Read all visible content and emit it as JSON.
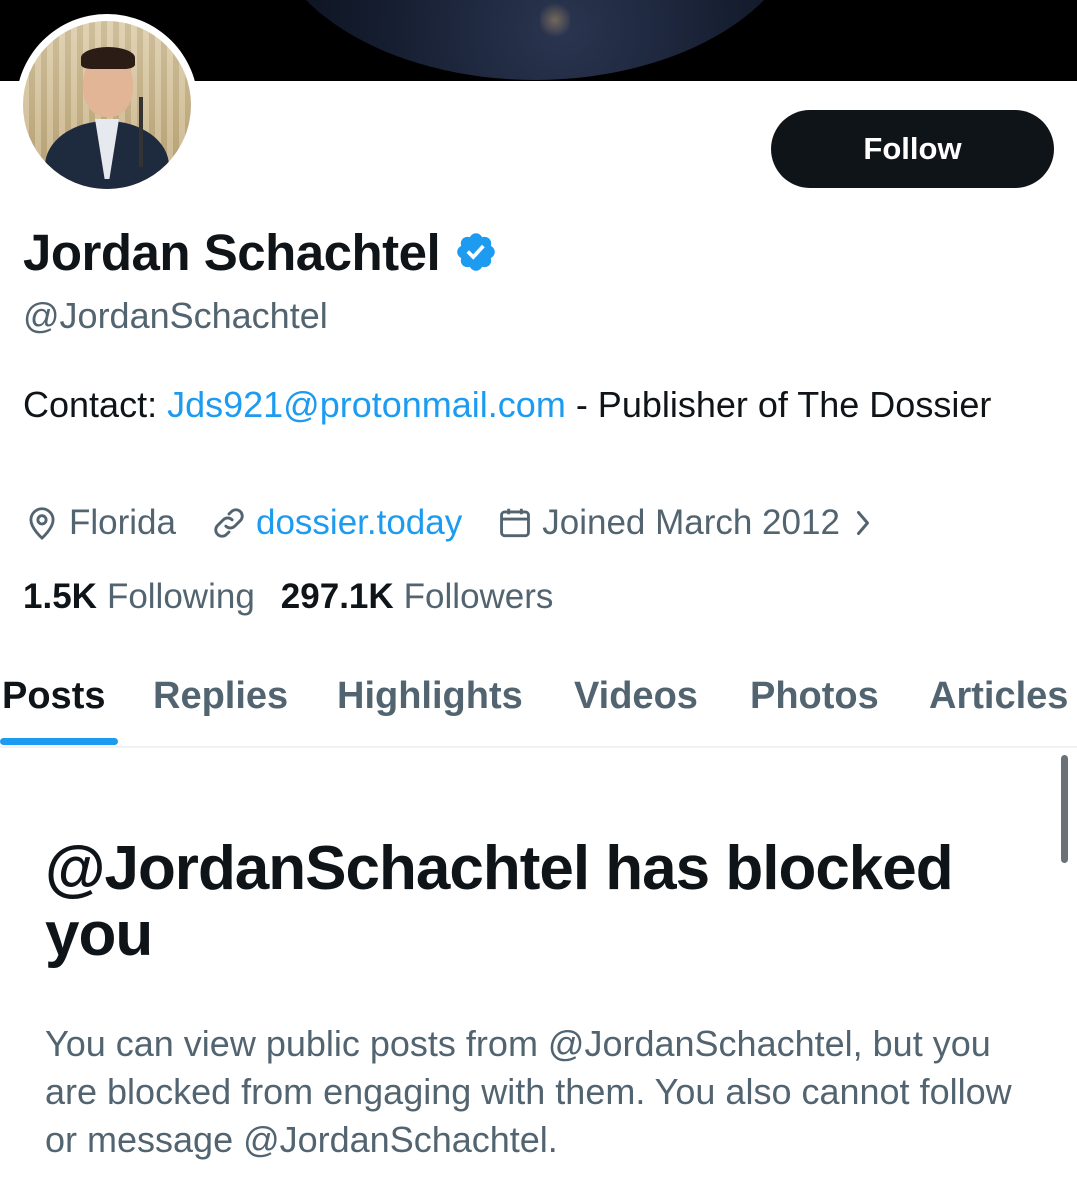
{
  "profile": {
    "display_name": "Jordan Schachtel",
    "handle": "@JordanSchachtel",
    "verified": true,
    "follow_label": "Follow",
    "bio": {
      "prefix": "Contact: ",
      "email_link": "Jds921@protonmail.com",
      "suffix": " - Publisher of The Dossier"
    },
    "location": "Florida",
    "website": "dossier.today",
    "joined": "Joined March 2012",
    "following_count": "1.5K",
    "following_label": "Following",
    "followers_count": "297.1K",
    "followers_label": "Followers"
  },
  "tabs": [
    {
      "label": "Posts",
      "active": true
    },
    {
      "label": "Replies",
      "active": false
    },
    {
      "label": "Highlights",
      "active": false
    },
    {
      "label": "Videos",
      "active": false
    },
    {
      "label": "Photos",
      "active": false
    },
    {
      "label": "Articles",
      "active": false
    }
  ],
  "blocked": {
    "title": "@JordanSchachtel has blocked you",
    "description": "You can view public posts from @JordanSchachtel, but you are blocked from engaging with them. You also cannot follow or message @JordanSchachtel."
  },
  "icons": {
    "verified": "verified-badge-icon",
    "location": "location-pin-icon",
    "website": "link-icon",
    "joined": "calendar-icon",
    "joined_more": "chevron-right-icon"
  },
  "colors": {
    "accent": "#1d9bf0",
    "text_primary": "#0f1419",
    "text_secondary": "#536471",
    "button_bg": "#0f1419"
  }
}
